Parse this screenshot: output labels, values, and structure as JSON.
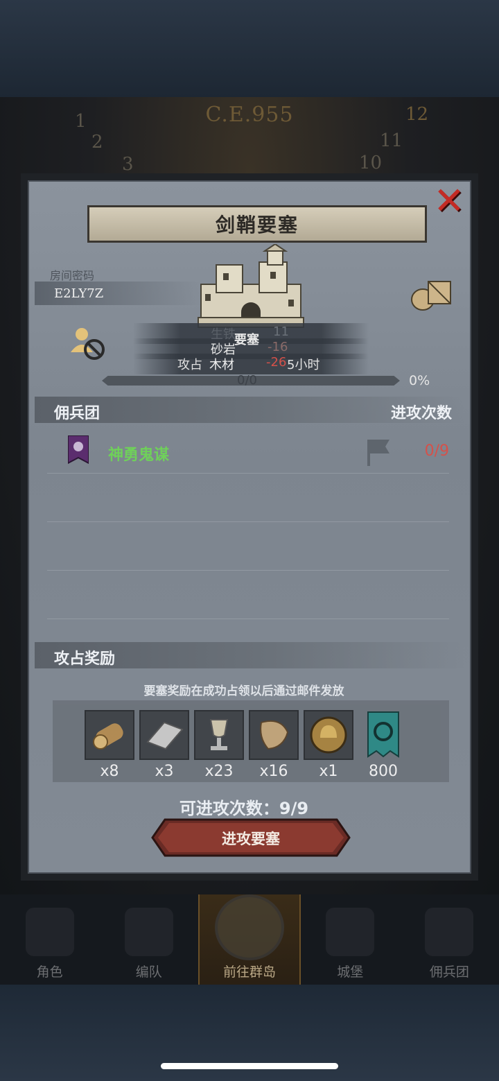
{
  "background": {
    "era_label": "C.E.955",
    "clock_numbers": [
      "1",
      "2",
      "3",
      "12",
      "11",
      "10"
    ]
  },
  "modal": {
    "title": "剑鞘要塞",
    "room_label": "房间密码",
    "room_code": "E2LY7Z",
    "overlay_lines": [
      {
        "label": "生铁",
        "value": "11"
      },
      {
        "label": "要塞",
        "value": ""
      },
      {
        "label": "砂岩",
        "value": "-16"
      },
      {
        "label": "攻占",
        "value": ""
      },
      {
        "label": "木材",
        "value": "-26"
      },
      {
        "label": "5小时",
        "value": ""
      }
    ],
    "progress": {
      "count": "0/0",
      "percent_text": "0%",
      "fraction": 0
    },
    "mercenary_header": "佣兵团",
    "attack_count_header": "进攻次数",
    "mercenary": {
      "name": "神勇鬼谋",
      "count": "0/9"
    },
    "reward_header": "攻占奖励",
    "reward_note": "要塞奖励在成功占领以后通过邮件发放",
    "rewards": [
      {
        "icon": "log-icon",
        "qty": "x8"
      },
      {
        "icon": "iron-ingot-icon",
        "qty": "x3"
      },
      {
        "icon": "goblet-icon",
        "qty": "x23"
      },
      {
        "icon": "fur-pelt-icon",
        "qty": "x16"
      },
      {
        "icon": "helmet-medal-icon",
        "qty": "x1"
      },
      {
        "icon": "guild-banner-icon",
        "qty": "800"
      }
    ],
    "attempts_text": "可进攻次数：9/9",
    "attack_button": "进攻要塞",
    "colors": {
      "merc_name": "#6fd05a",
      "merc_count": "#d5514a",
      "close": "#c32b25"
    }
  },
  "bottom_nav": [
    {
      "label": "角色",
      "active": false
    },
    {
      "label": "编队",
      "active": false
    },
    {
      "label": "前往群岛",
      "active": true
    },
    {
      "label": "城堡",
      "active": false
    },
    {
      "label": "佣兵团",
      "active": false
    }
  ]
}
